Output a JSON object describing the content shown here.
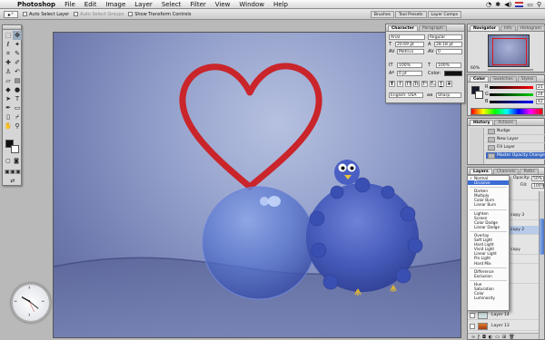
{
  "menubar": {
    "app_name": "Photoshop",
    "items": [
      "File",
      "Edit",
      "Image",
      "Layer",
      "Select",
      "Filter",
      "View",
      "Window",
      "Help"
    ]
  },
  "options_bar": {
    "auto_select_layer": "Auto Select Layer",
    "auto_select_groups": "Auto Select Groups",
    "show_transform": "Show Transform Controls",
    "palette_well": [
      "Brushes",
      "Tool Presets",
      "Layer Comps"
    ]
  },
  "character": {
    "tabs": [
      "Character",
      "Paragraph"
    ],
    "font": "Arial",
    "style": "Regular",
    "size": "20.69 pt",
    "leading": "28.18 pt",
    "tracking": "0",
    "kerning": "Metrics",
    "vscale": "100%",
    "hscale": "100%",
    "baseline": "0 pt",
    "color_label": "Color:",
    "language": "English: USA",
    "antialias": "Sharp"
  },
  "navigator": {
    "tabs": [
      "Navigator",
      "Info",
      "Histogram"
    ],
    "zoom": "60%"
  },
  "color_panel": {
    "tabs": [
      "Color",
      "Swatches",
      "Styles"
    ],
    "rows": [
      {
        "label": "R",
        "value": "21"
      },
      {
        "label": "G",
        "value": "24"
      },
      {
        "label": "B",
        "value": "42"
      }
    ]
  },
  "history": {
    "tabs": [
      "History",
      "Actions"
    ],
    "rows": [
      "Nudge",
      "New Layer",
      "Fill Layer",
      "Master Opacity Change"
    ]
  },
  "layers": {
    "tabs": [
      "Layers",
      "Channels",
      "Paths"
    ],
    "blend_mode": "Normal",
    "opacity_label": "Opacity:",
    "opacity": "50%",
    "fill_label": "Fill:",
    "fill": "100%",
    "rows": [
      "Layer 3",
      "Layer 10 copy 3",
      "Layer 10 copy 2",
      "Layer 10 copy",
      "Layer 10",
      "Layer 6",
      "Layer 14",
      "Layer 13"
    ]
  },
  "blend_menu": {
    "groups": [
      [
        "Normal",
        "Dissolve"
      ],
      [
        "Darken",
        "Multiply",
        "Color Burn",
        "Linear Burn"
      ],
      [
        "Lighten",
        "Screen",
        "Color Dodge",
        "Linear Dodge"
      ],
      [
        "Overlay",
        "Soft Light",
        "Hard Light",
        "Vivid Light",
        "Linear Light",
        "Pin Light",
        "Hard Mix"
      ],
      [
        "Difference",
        "Exclusion"
      ],
      [
        "Hue",
        "Saturation",
        "Color",
        "Luminosity"
      ]
    ],
    "checked": "Normal",
    "highlighted": "Dissolve"
  },
  "colors": {
    "heart": "#c9252b",
    "canvas_dark": "#5b6596",
    "canvas_light": "#b6c1e0",
    "bird_blue": "#3f53b7",
    "bubble": "#5a78d0"
  }
}
